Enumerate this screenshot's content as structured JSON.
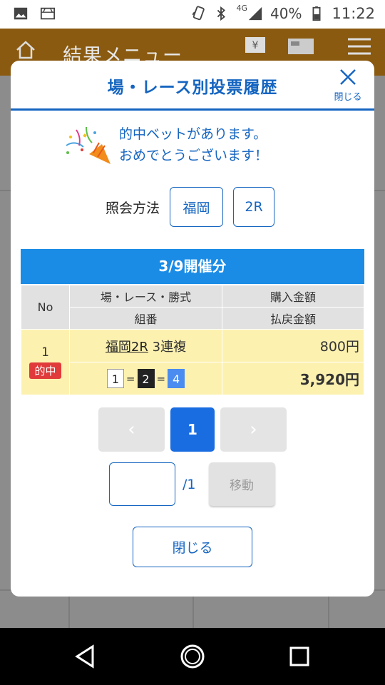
{
  "status_bar": {
    "network": "4G",
    "battery_percent": "40%",
    "time": "11:22",
    "icons": [
      "gallery-icon",
      "cast-icon",
      "nfc-icon",
      "bluetooth-icon",
      "signal-icon",
      "battery-icon"
    ]
  },
  "background_app": {
    "title": "結果メニュー",
    "icons": [
      "home-icon",
      "yen-ticket-icon",
      "machine-icon",
      "hamburger-menu-icon"
    ]
  },
  "modal": {
    "title": "場・レース別投票履歴",
    "close_icon_label": "閉じる",
    "congrats_line1": "的中ベットがあります。",
    "congrats_line2": "おめでとうございます！",
    "query_label": "照会方法",
    "query_venue": "福岡",
    "query_race": "2R",
    "date_header": "3/9開催分",
    "table": {
      "headers": {
        "no": "No",
        "race_type": "場・レース・勝式",
        "purchase": "購入金額",
        "combination": "組番",
        "payout": "払戻金額"
      },
      "rows": [
        {
          "no": "1",
          "badge": "的中",
          "race_link": "福岡2R",
          "bet_type": "3連複",
          "combo": [
            "1",
            "2",
            "4"
          ],
          "combo_separator": "=",
          "purchase": "800円",
          "payout": "3,920円"
        }
      ]
    },
    "pager": {
      "prev": "‹",
      "current": "1",
      "next": "›"
    },
    "goto": {
      "value": "",
      "total": "/1",
      "button": "移動"
    },
    "close_button": "閉じる"
  },
  "colors": {
    "accent": "#1565c0",
    "date_bar": "#1a8ce6",
    "hit_row": "#fdf1b0",
    "hit_badge": "#e03a3a"
  }
}
